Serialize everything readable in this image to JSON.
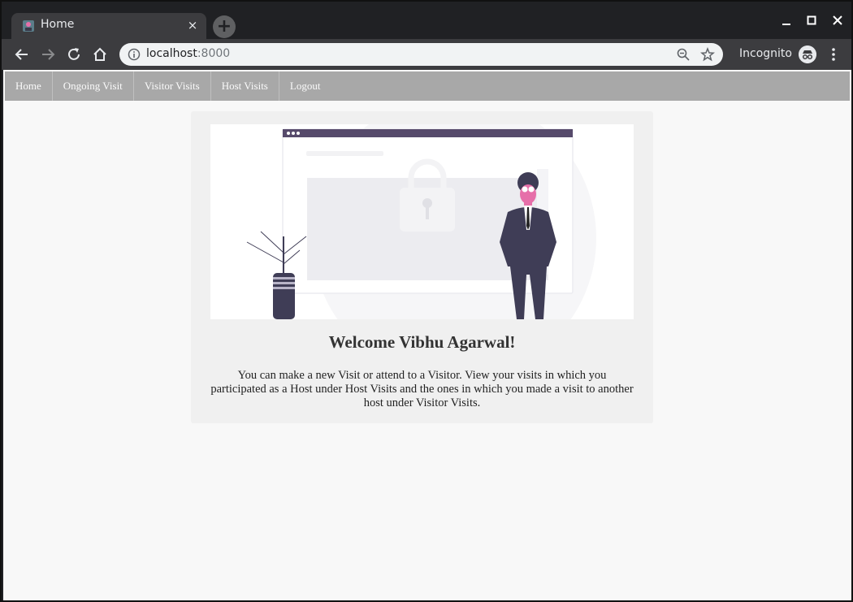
{
  "browser": {
    "tab_title": "Home",
    "tab_close": "×",
    "new_tab": "+",
    "url_host": "localhost",
    "url_port": ":8000",
    "profile_label": "Incognito",
    "icons": [
      "back-icon",
      "forward-icon",
      "reload-icon",
      "home-icon",
      "info-icon",
      "zoom-out-icon",
      "star-icon",
      "incognito-icon",
      "menu-icon",
      "minimize-icon",
      "maximize-icon",
      "close-icon"
    ]
  },
  "navbar": {
    "items": [
      {
        "label": "Home"
      },
      {
        "label": "Ongoing Visit"
      },
      {
        "label": "Visitor Visits"
      },
      {
        "label": "Host Visits"
      },
      {
        "label": "Logout"
      }
    ]
  },
  "main": {
    "welcome": "Welcome Vibhu Agarwal!",
    "description": "You can make a new Visit or attend to a Visitor. View your visits in which you participated as a Host under Host Visits and the ones in which you made a visit to another host under Visitor Visits."
  },
  "colors": {
    "illustration_primary": "#564a6b",
    "accent": "#e66fa9",
    "navbar_bg": "#a8a8a8"
  }
}
